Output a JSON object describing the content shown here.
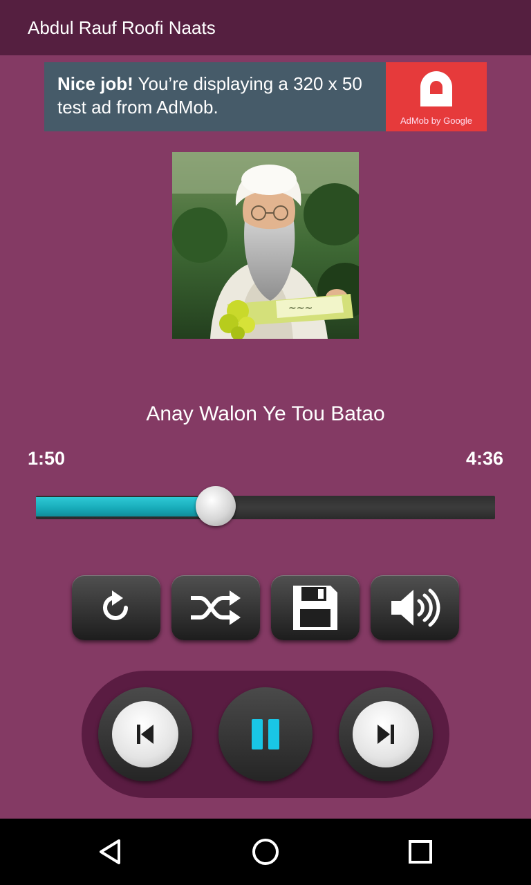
{
  "app_bar": {
    "title": "Abdul Rauf Roofi Naats"
  },
  "ad": {
    "headline": "Nice job!",
    "body": " You’re displaying a 320 x 50 test ad from AdMob.",
    "brand": "AdMob by Google",
    "brand_color": "#e63a3b"
  },
  "album_art": {
    "description_icon": "artist-photo"
  },
  "track": {
    "title": "Anay Walon Ye Tou Batao"
  },
  "playback": {
    "elapsed": "1:50",
    "duration": "4:36",
    "progress_fraction": 0.392,
    "progress_color": "#17aab8"
  },
  "controls": {
    "repeat_icon": "repeat-icon",
    "shuffle_icon": "shuffle-icon",
    "save_icon": "save-icon",
    "volume_icon": "volume-icon",
    "previous_icon": "skip-previous-icon",
    "pause_icon": "pause-icon",
    "next_icon": "skip-next-icon",
    "pause_color": "#19c6e6"
  },
  "nav_bar": {
    "back_icon": "back-icon",
    "home_icon": "home-icon",
    "recents_icon": "recents-icon"
  },
  "theme": {
    "background": "#843a64",
    "app_bar": "#551f40",
    "dock": "#5a1c42"
  }
}
